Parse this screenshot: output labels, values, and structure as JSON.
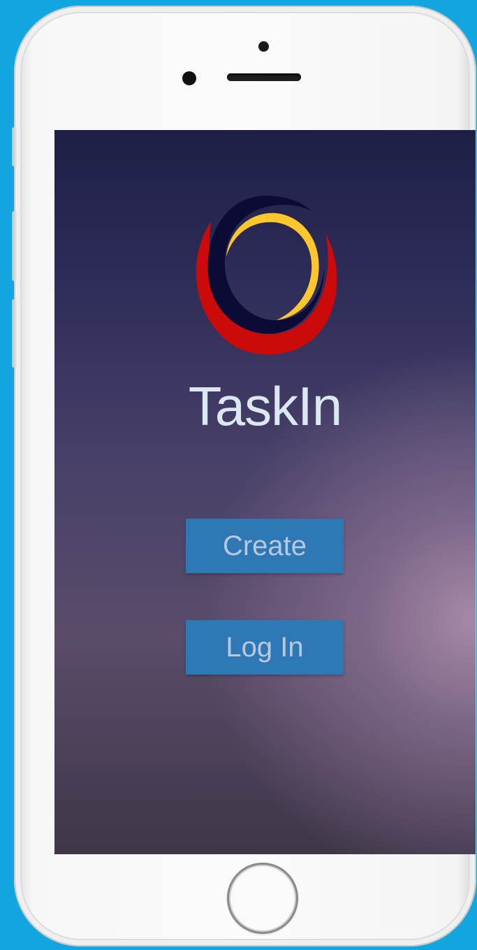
{
  "app": {
    "title": "TaskIn"
  },
  "buttons": {
    "create_label": "Create",
    "login_label": "Log In"
  },
  "logo": {
    "name": "taskin-logo",
    "colors": {
      "outer": "#cc0a0a",
      "middle": "#0c0b35",
      "inner": "#ffc72c"
    }
  },
  "colors": {
    "background": "#12a6e0",
    "button": "#2f78b6",
    "title": "#dbe8f4"
  }
}
